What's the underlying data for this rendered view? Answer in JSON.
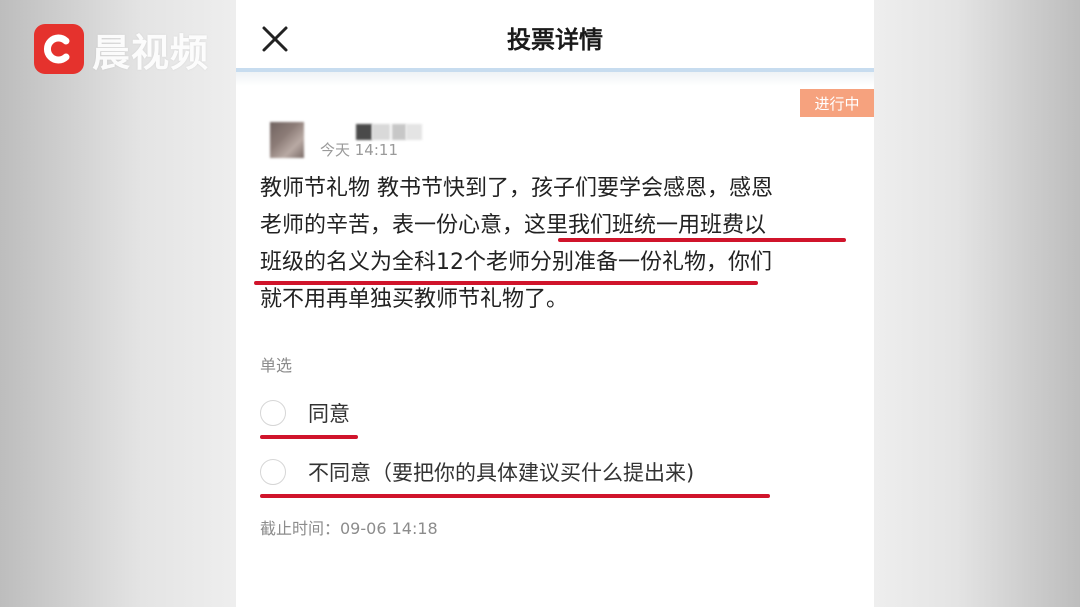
{
  "watermark": {
    "text": "晨视频",
    "icon": "play-logo-icon",
    "color": "#e5322d"
  },
  "header": {
    "title": "投票详情",
    "close_icon": "close-icon"
  },
  "status": {
    "label": "进行中",
    "color": "#f6a27e"
  },
  "post": {
    "time": "今天 14:11",
    "text_lines": [
      "教师节礼物 教书节快到了，孩子们要学会感恩，感恩",
      "老师的辛苦，表一份心意，这里我们班统一用班费以",
      "班级的名义为全科12个老师分别准备一份礼物，你们",
      "就不用再单独买教师节礼物了。"
    ]
  },
  "vote": {
    "type": "单选",
    "options": [
      {
        "label": "同意"
      },
      {
        "label": "不同意（要把你的具体建议买什么提出来)"
      }
    ],
    "deadline": "截止时间：09-06 14:18"
  },
  "colors": {
    "underline": "#d0142b",
    "divider": "#c7dcef"
  }
}
